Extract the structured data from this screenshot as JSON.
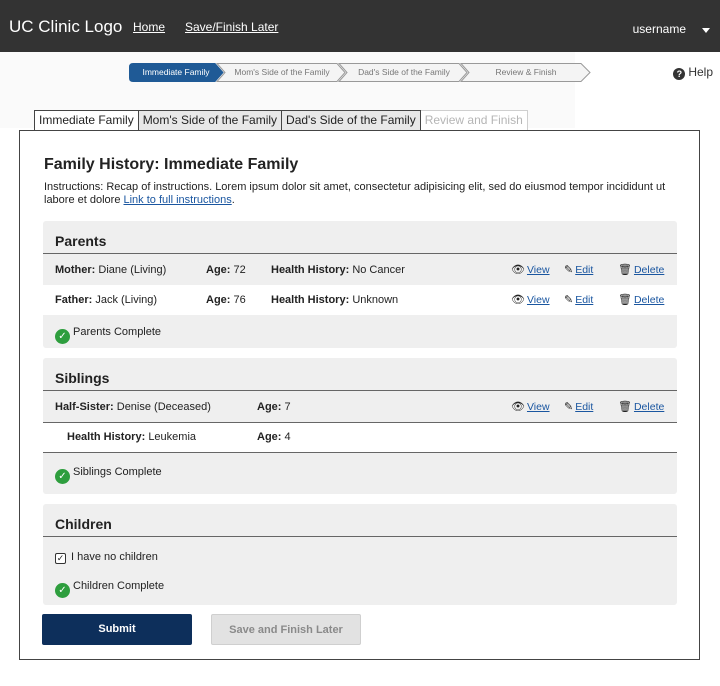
{
  "header": {
    "logo": "UC Clinic Logo",
    "home_link": "Home",
    "save_link": "Save/Finish Later",
    "username": "username"
  },
  "steps": {
    "items": [
      "Immediate Family",
      "Mom's Side of the Family",
      "Dad's Side of the Family",
      "Review & Finish"
    ],
    "active_index": 0,
    "help": "Help"
  },
  "tabs": {
    "items": [
      "Immediate Family",
      "Mom's Side of the Family",
      "Dad's Side of the Family",
      "Review and Finish"
    ]
  },
  "page": {
    "title": "Family History: Immediate Family",
    "instructions": "Instructions:  Recap of instructions. Lorem ipsum dolor sit amet, consectetur adipisicing elit, sed do eiusmod tempor incididunt ut labore et dolore ",
    "instructions_link": "Link to full instructions",
    "instructions_end": "."
  },
  "actions": {
    "view": "View",
    "edit": "Edit",
    "delete": "Delete"
  },
  "parents": {
    "title": "Parents",
    "rows": [
      {
        "relation": "Mother:",
        "name": "Diane (Living)",
        "age_label": "Age:",
        "age": "72",
        "hh_label": "Health History:",
        "hh": "No Cancer"
      },
      {
        "relation": "Father:",
        "name": "Jack (Living)",
        "age_label": "Age:",
        "age": "76",
        "hh_label": "Health History:",
        "hh": "Unknown"
      }
    ],
    "complete": "Parents Complete"
  },
  "siblings": {
    "title": "Siblings",
    "row": {
      "relation": "Half-Sister:",
      "name": "Denise (Deceased)",
      "age_label": "Age:",
      "age": "7"
    },
    "sub_row": {
      "hh_label": "Health History:",
      "hh": "Leukemia",
      "age_label": "Age:",
      "age": "4"
    },
    "complete": "Siblings Complete"
  },
  "children": {
    "title": "Children",
    "no_children_label": "I have no children",
    "no_children_checked": true,
    "complete": "Children Complete"
  },
  "buttons": {
    "submit": "Submit",
    "save_later": "Save and Finish Later"
  },
  "colors": {
    "topbar": "#333333",
    "active_step": "#1f5a96",
    "submit": "#0d2f5b",
    "complete": "#2e9e3e"
  }
}
